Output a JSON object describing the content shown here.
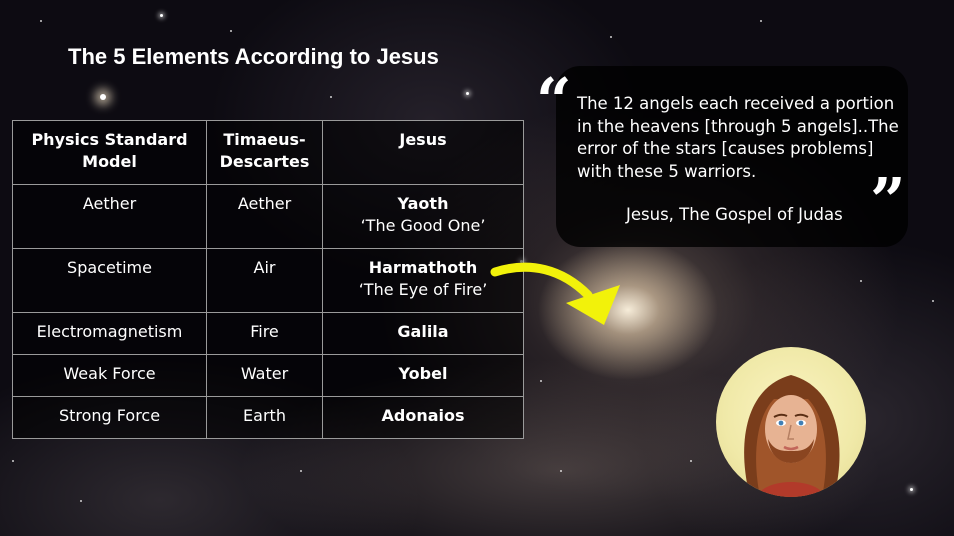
{
  "slide": {
    "title": "The 5 Elements According to Jesus"
  },
  "table": {
    "headers": [
      "Physics Standard Model",
      "Timaeus-Descartes",
      "Jesus"
    ],
    "rows": [
      {
        "physics": "Aether",
        "timaeus": "Aether",
        "jesus": "Yaoth",
        "jesus_sub": "‘The Good One’"
      },
      {
        "physics": "Spacetime",
        "timaeus": "Air",
        "jesus": "Harmathoth",
        "jesus_sub": "‘The Eye of Fire’"
      },
      {
        "physics": "Electromagnetism",
        "timaeus": "Fire",
        "jesus": "Galila"
      },
      {
        "physics": "Weak Force",
        "timaeus": "Water",
        "jesus": "Yobel"
      },
      {
        "physics": "Strong Force",
        "timaeus": "Earth",
        "jesus": "Adonaios"
      }
    ]
  },
  "quote": {
    "open_mark": "“",
    "close_mark": "”",
    "text": "The 12 angels each received a portion in the heavens [through 5 angels]..The error of the stars [causes problems] with these 5 warriors.",
    "attribution": "Jesus, The Gospel of Judas"
  },
  "icons": {
    "arrow": "arrow-right-curved-icon",
    "portrait": "jesus-portrait"
  },
  "colors": {
    "arrow": "#f2f20a",
    "quote_box": "#000000",
    "background": "#0d0b12"
  }
}
